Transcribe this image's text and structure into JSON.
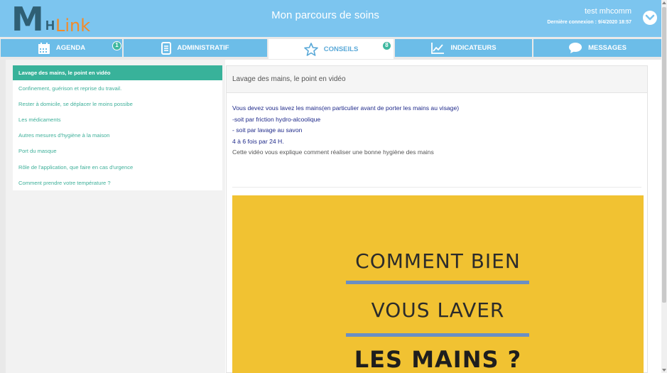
{
  "header": {
    "logo": {
      "m": "M",
      "h": "H",
      "link": "Link"
    },
    "title": "Mon parcours de soins",
    "user_name": "test mhcomm",
    "last_connection": "Dernière connexion : 9/4/2020 18:57"
  },
  "tabs": [
    {
      "label": "AGENDA",
      "icon": "calendar-icon",
      "badge": "1",
      "active": false
    },
    {
      "label": "ADMINISTRATIF",
      "icon": "document-icon",
      "active": false
    },
    {
      "label": "CONSEILS",
      "icon": "star-icon",
      "badge": "8",
      "active": true
    },
    {
      "label": "INDICATEURS",
      "icon": "chart-icon",
      "active": false
    },
    {
      "label": "MESSAGES",
      "icon": "chat-icon",
      "active": false
    }
  ],
  "sidebar": {
    "items": [
      {
        "label": "Lavage des mains, le point en vidéo",
        "active": true
      },
      {
        "label": "Confinement, guérison et reprise du travail."
      },
      {
        "label": "Rester à domicile, se déplacer le moins possibe"
      },
      {
        "label": "Les médicaments"
      },
      {
        "label": "Autres mesures d'hygiène à la maison"
      },
      {
        "label": "Port du masque"
      },
      {
        "label": "Rôle de l'application, que faire en cas d'urgence"
      },
      {
        "label": "Comment prendre votre température ?"
      }
    ]
  },
  "content": {
    "title": "Lavage des mains, le point en vidéo",
    "lines": [
      "Vous devez vous lavez les mains(en particulier avant de porter les mains au visage)",
      "-soit par friction hydro-alcoolique",
      "- soit par lavage au savon",
      "4 à 6 fois par 24 H.",
      "Cette vidéo vous explique comment réaliser une bonne hygiène des mains"
    ],
    "video": {
      "line1": "COMMENT BIEN",
      "line2": "VOUS LAVER",
      "line3": "LES MAINS ?"
    }
  },
  "colors": {
    "header_bg": "#7cc5ef",
    "tab_bg": "#6cbde8",
    "accent_green": "#38b29a",
    "text_blue": "#1f2a8a",
    "logo_orange": "#f28b2a",
    "video_yellow": "#f1c232"
  }
}
